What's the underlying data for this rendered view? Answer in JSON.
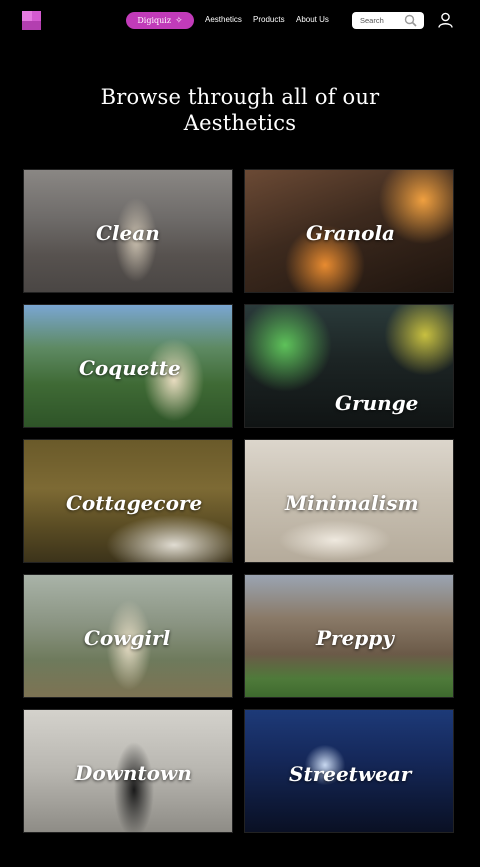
{
  "nav": {
    "quiz_label": "Digiquiz",
    "links": [
      "Aesthetics",
      "Products",
      "About Us"
    ],
    "search_placeholder": "Search"
  },
  "heading": {
    "line1": "Browse through all of our",
    "line2": "Aesthetics"
  },
  "aesthetics": [
    {
      "label": "Clean"
    },
    {
      "label": "Granola"
    },
    {
      "label": "Coquette"
    },
    {
      "label": "Grunge"
    },
    {
      "label": "Cottagecore"
    },
    {
      "label": "Minimalism"
    },
    {
      "label": "Cowgirl"
    },
    {
      "label": "Preppy"
    },
    {
      "label": "Downtown"
    },
    {
      "label": "Streetwear"
    }
  ],
  "colors": {
    "accent": "#c13bb9",
    "background": "#000000"
  }
}
